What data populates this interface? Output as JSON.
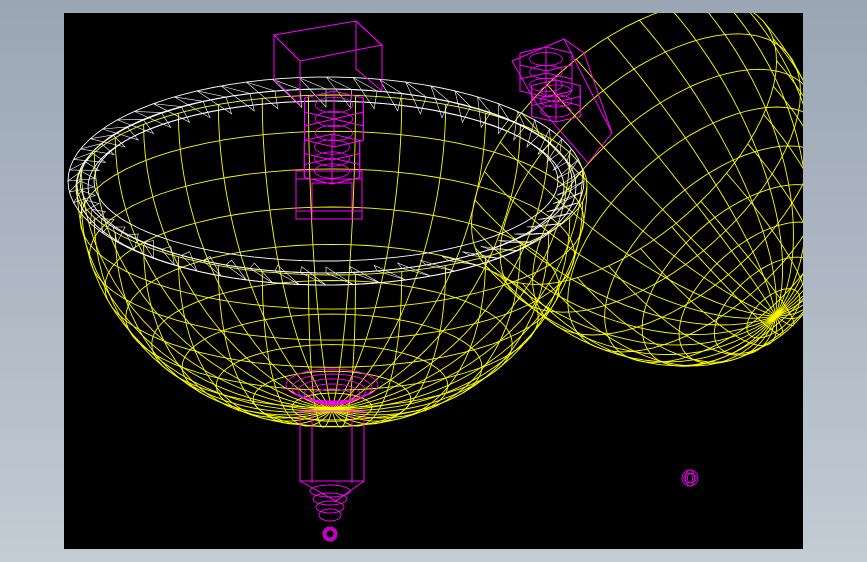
{
  "viewport": {
    "background_color": "#000000",
    "frame_color": "#a9b4c0"
  },
  "colors": {
    "bowl_wire": "#ffff00",
    "rim_wire": "#ffffff",
    "fitting_wire": "#ff00ff"
  },
  "scene": {
    "description_icon": "wireframe-3d-model",
    "objects": [
      "open-hemispherical-bowl",
      "closed-hemispherical-cap",
      "hex-fitting-top",
      "hex-fitting-cap",
      "bottom-drain-fitting",
      "small-ball-marker"
    ]
  }
}
